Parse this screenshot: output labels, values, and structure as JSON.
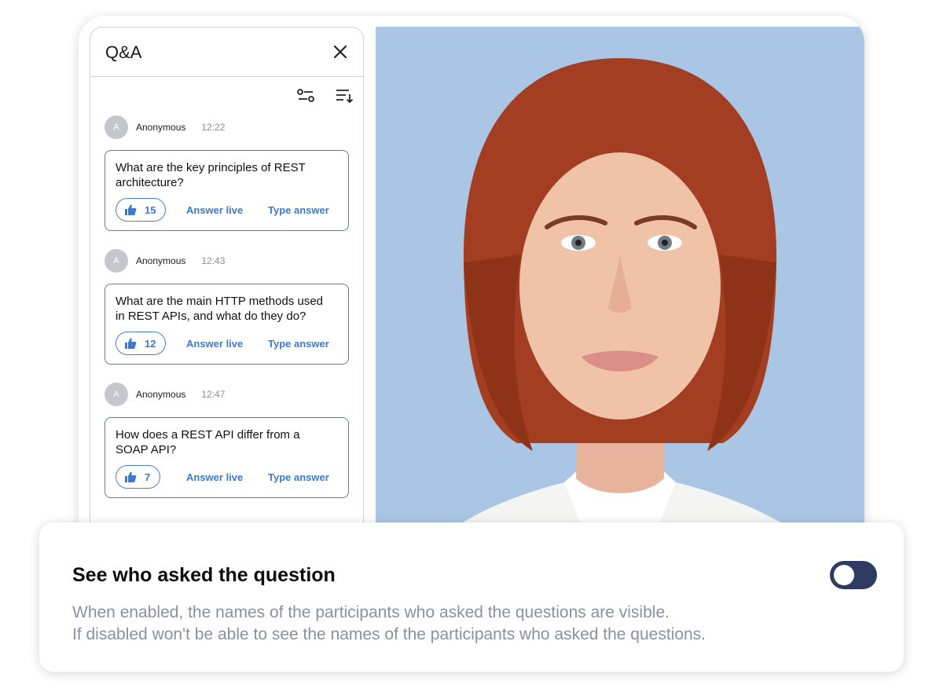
{
  "qa": {
    "title": "Q&A",
    "questions": [
      {
        "avatar_letter": "A",
        "author": "Anonymous",
        "time": "12:22",
        "text": "What are the key principles of REST architecture?",
        "likes": "15",
        "answer_live": "Answer live",
        "type_answer": "Type answer"
      },
      {
        "avatar_letter": "A",
        "author": "Anonymous",
        "time": "12:43",
        "text": "What are the main HTTP methods used in REST APIs, and what do they do?",
        "likes": "12",
        "answer_live": "Answer live",
        "type_answer": "Type answer"
      },
      {
        "avatar_letter": "A",
        "author": "Anonymous",
        "time": "12:47",
        "text": "How does a REST API differ from a SOAP API?",
        "likes": "7",
        "answer_live": "Answer live",
        "type_answer": "Type answer"
      }
    ]
  },
  "setting": {
    "title": "See who asked the question",
    "description_line1": "When enabled, the names of the participants who asked the questions are visible.",
    "description_line2": "If disabled won't be able to see the names of the participants who asked the questions.",
    "enabled": false
  },
  "colors": {
    "accent": "#3b79d3",
    "toggle_track": "#2f3a63",
    "video_background": "#aac6e4"
  }
}
